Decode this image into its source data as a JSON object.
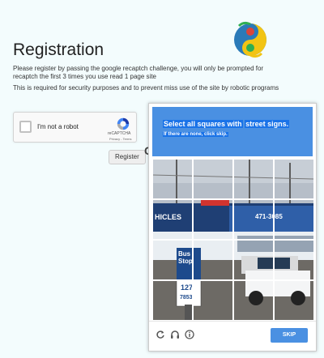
{
  "page": {
    "title": "Registration",
    "intro": "Please register by passing the google recaptch challenge, you will only be prompted for recaptch the first 3 times you use read 1 page site",
    "security_note": "This is required for security purposes and to prevent miss use of the site by robotic programs",
    "register_label": "Register",
    "obscured_heading_char": "C"
  },
  "recaptcha": {
    "label": "I'm not a robot",
    "brand": "reCAPTCHA",
    "terms": "Privacy - Terms"
  },
  "challenge": {
    "instruction": "Select all squares with",
    "keyword": "street signs.",
    "subtext": "If there are none, click skip.",
    "skip_label": "SKIP",
    "header_color": "#4a90e2",
    "photo_text": {
      "store_sign": "HICLES",
      "phone": "471-3085",
      "bus_sign": "Bus Stop",
      "route": "127",
      "route_number": "7853"
    },
    "grid": {
      "rows": 4,
      "cols": 4,
      "selected": []
    }
  },
  "colors": {
    "background": "#f3fcfd",
    "accent": "#4a90e2",
    "checkbox_border": "#c1c1c1"
  }
}
